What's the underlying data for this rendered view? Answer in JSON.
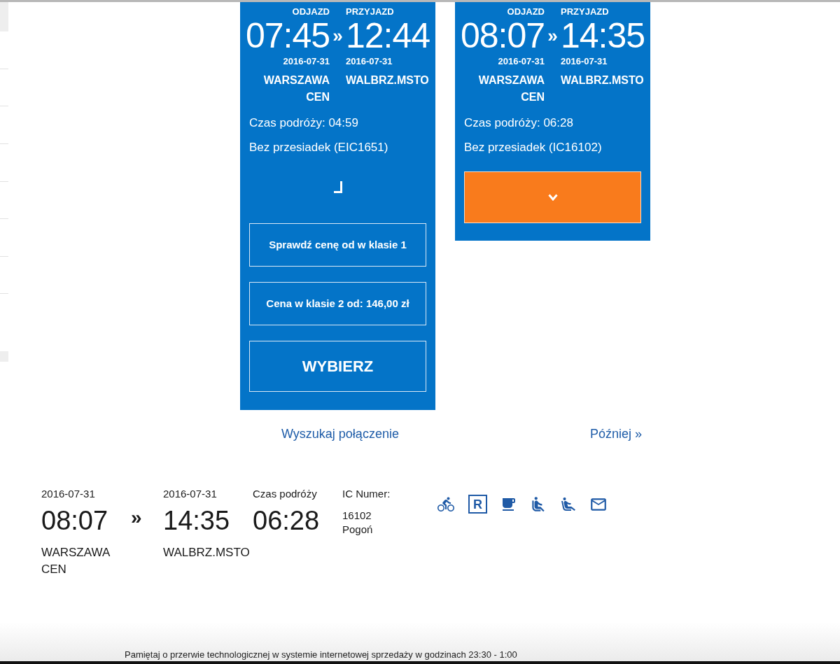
{
  "connections": [
    {
      "departure_label": "ODJAZD",
      "arrival_label": "PRZYJAZD",
      "departure_time": "07:45",
      "separator": "»",
      "arrival_time": "12:44",
      "departure_date": "2016-07-31",
      "arrival_date": "2016-07-31",
      "from": "WARSZAWA CEN",
      "to": "WALBRZ.MSTO",
      "duration": "Czas podróży: 04:59",
      "transfers": "Bez przesiadek (EIC1651)",
      "expanded": true,
      "buttons": [
        {
          "kind": "outline",
          "label": "Sprawdź cenę od w klasie 1"
        },
        {
          "kind": "outline",
          "label": "Cena w klasie 2 od: 146,00 zł"
        },
        {
          "kind": "select",
          "label": "WYBIERZ"
        }
      ]
    },
    {
      "departure_label": "ODJAZD",
      "arrival_label": "PRZYJAZD",
      "departure_time": "08:07",
      "separator": "»",
      "arrival_time": "14:35",
      "departure_date": "2016-07-31",
      "arrival_date": "2016-07-31",
      "from": "WARSZAWA CEN",
      "to": "WALBRZ.MSTO",
      "duration": "Czas podróży: 06:28",
      "transfers": "Bez przesiadek (IC16102)",
      "expanded": false
    }
  ],
  "nav_links": [
    {
      "label": "Wyszukaj połączenie"
    },
    {
      "label": "Później »"
    }
  ],
  "details": {
    "departure_date": "2016-07-31",
    "departure_time": "08:07",
    "from": "WARSZAWA CEN",
    "separator": "»",
    "arrival_date": "2016-07-31",
    "arrival_time": "14:35",
    "to": "WALBRZ.MSTO",
    "duration_label": "Czas podróży",
    "duration": "06:28",
    "train_label": "IC Numer:",
    "train_number": "16102",
    "train_name": "Pogoń",
    "reservation_mark": "R"
  },
  "footer_notice": "Pamiętaj o przerwie technologicznej w systemie internetowej sprzedaży w godzinach 23:30 - 1:00"
}
